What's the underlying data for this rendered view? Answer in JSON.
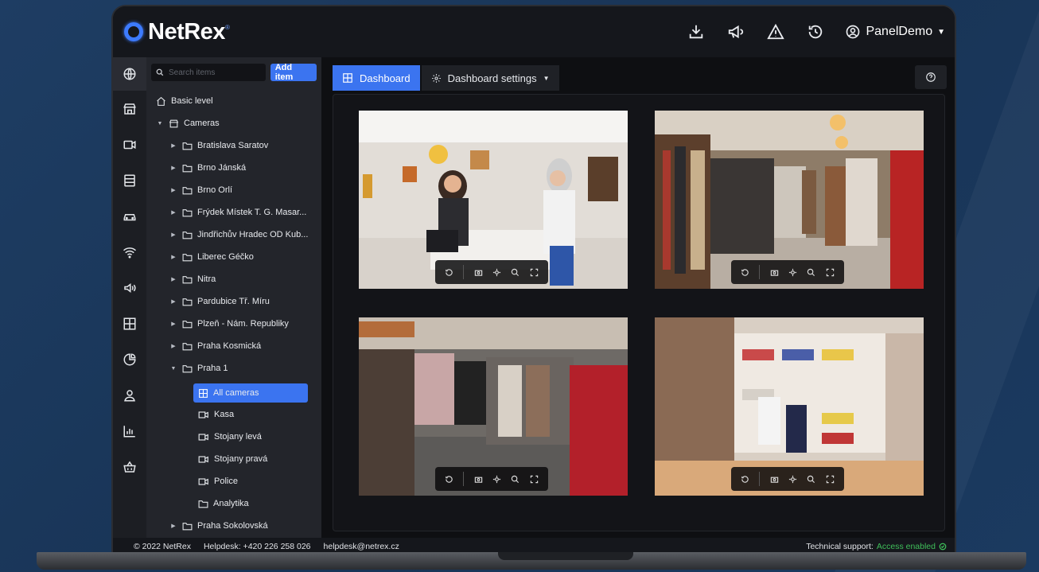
{
  "app": {
    "name": "NetRex",
    "tm": "®"
  },
  "header": {
    "icons": [
      "download-icon",
      "megaphone-icon",
      "warning-icon",
      "history-icon"
    ],
    "user": "PanelDemo"
  },
  "rail": [
    "globe-icon",
    "store-icon",
    "camera-icon",
    "server-icon",
    "car-icon",
    "wifi-icon",
    "speaker-icon",
    "grid-icon",
    "pie-chart-icon",
    "user-icon",
    "bar-chart-icon",
    "basket-icon"
  ],
  "tree": {
    "search_placeholder": "Search items",
    "add_label": "Add item",
    "basic_level": "Basic level",
    "cameras": "Cameras",
    "sites": [
      "Bratislava Saratov",
      "Brno Jánská",
      "Brno Orlí",
      "Frýdek Místek T. G. Masar...",
      "Jindřichův Hradec OD Kub...",
      "Liberec Géčko",
      "Nitra",
      "Pardubice Tř. Míru",
      "Plzeň - Nám. Republiky",
      "Praha Kosmická",
      "Praha 1"
    ],
    "praha1_children": [
      "All cameras",
      "Kasa",
      "Stojany levá",
      "Stojany pravá",
      "Police",
      "Analytika"
    ],
    "last_site": "Praha Sokolovská"
  },
  "tabs": {
    "dashboard": "Dashboard",
    "settings": "Dashboard settings"
  },
  "footer": {
    "copyright": "© 2022 NetRex",
    "helpdesk": "Helpdesk: +420 226 258 026",
    "email": "helpdesk@netrex.cz",
    "support_label": "Technical support:",
    "support_status": "Access enabled"
  }
}
